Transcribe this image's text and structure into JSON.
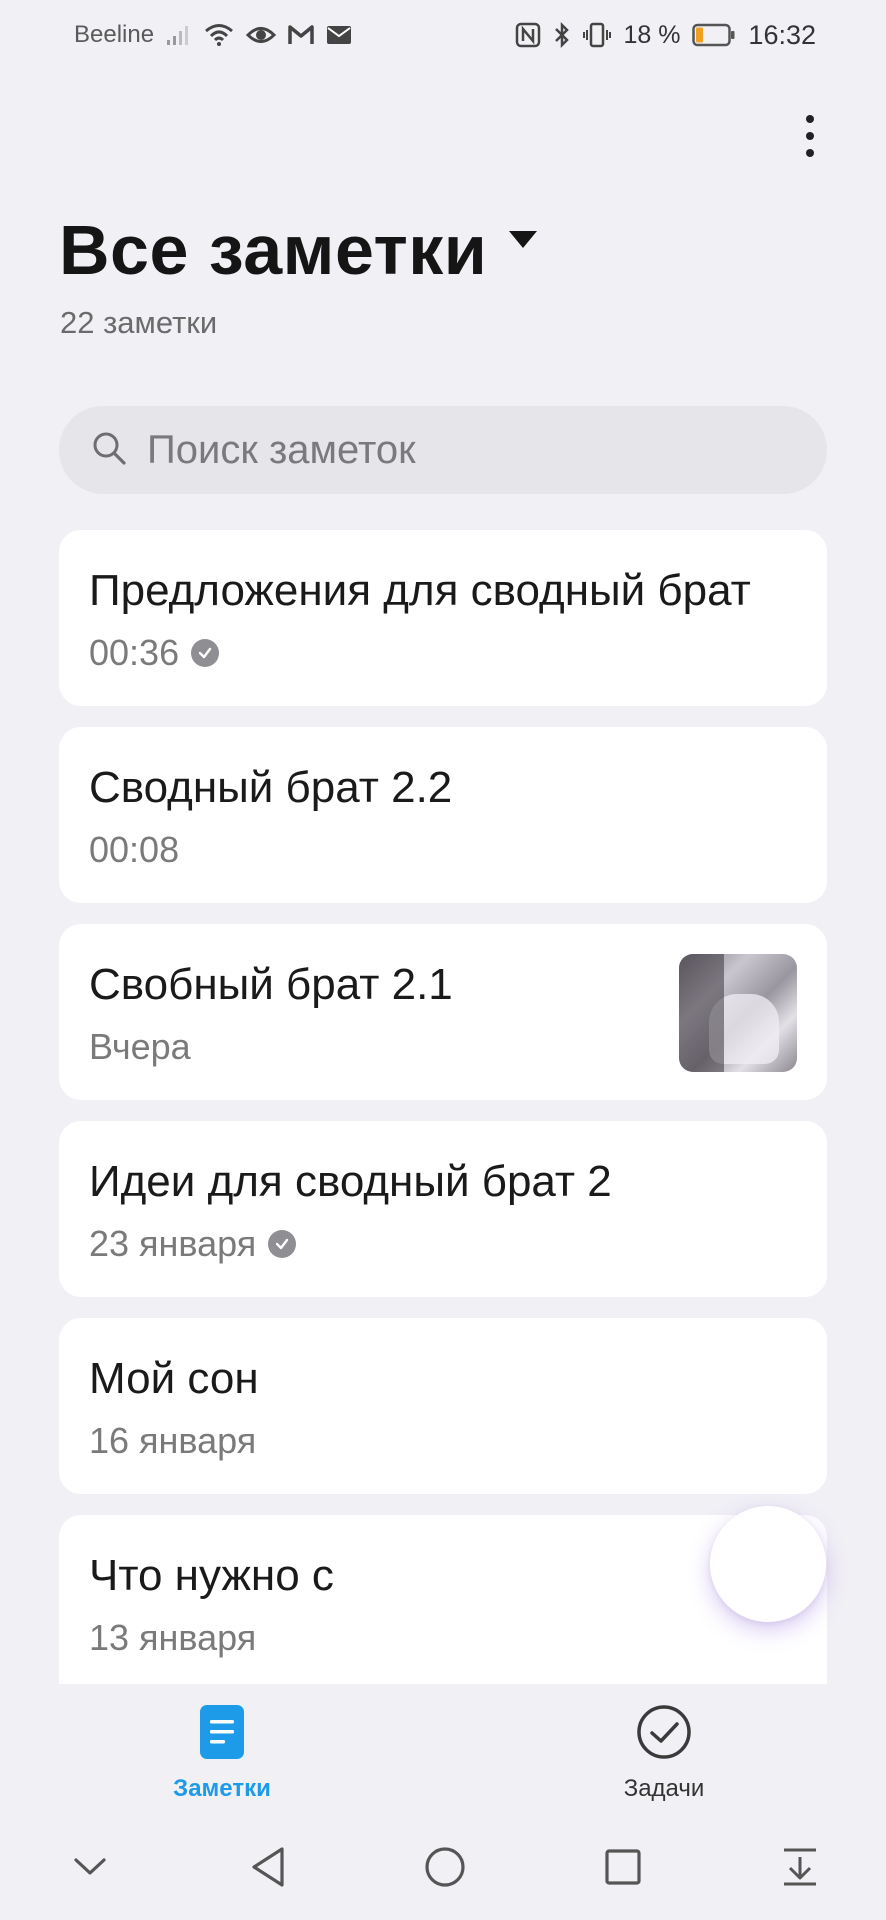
{
  "status_bar": {
    "carrier": "Beeline",
    "battery_percent": "18 %",
    "time": "16:32"
  },
  "header": {
    "title": "Все заметки",
    "count": "22 заметки"
  },
  "search": {
    "placeholder": "Поиск заметок"
  },
  "notes": [
    {
      "title": "Предложения для сводный брат",
      "meta": "00:36",
      "synced": true
    },
    {
      "title": "Сводный брат 2.2",
      "meta": "00:08",
      "synced": false
    },
    {
      "title": "Свобный брат 2.1",
      "meta": "Вчера",
      "synced": false,
      "has_thumbnail": true
    },
    {
      "title": "Идеи для сводный брат 2",
      "meta": "23 января",
      "synced": true
    },
    {
      "title": "Мой сон",
      "meta": "16 января",
      "synced": false
    },
    {
      "title": "Что нужно с",
      "meta": "13 января",
      "synced": false
    }
  ],
  "tabs": {
    "notes": "Заметки",
    "tasks": "Задачи",
    "active": "notes"
  },
  "colors": {
    "accent": "#1d9be8",
    "background": "#f1f0f5",
    "card": "#ffffff"
  }
}
